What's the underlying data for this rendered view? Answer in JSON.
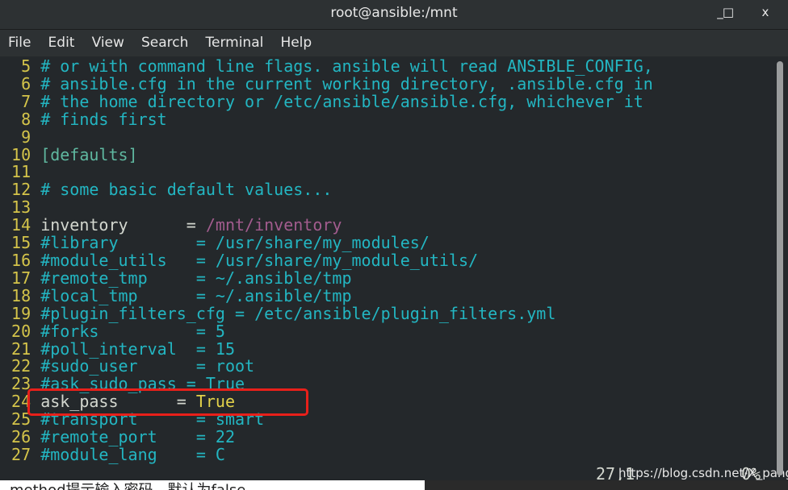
{
  "window": {
    "title": "root@ansible:/mnt",
    "minimize": "_",
    "maximize": "□",
    "close": "x"
  },
  "menu": [
    "File",
    "Edit",
    "View",
    "Search",
    "Terminal",
    "Help"
  ],
  "colors": {
    "comment": "#23b6c2",
    "linenum": "#d4c44a",
    "plain": "#d3d7cf",
    "path": "#a25c8e",
    "section": "#5fb8a0",
    "value_true": "#e3d24a",
    "highlight_box": "#e8201a"
  },
  "lines": [
    {
      "n": "5",
      "segs": [
        {
          "t": "# or with command line flags. ansible will read ANSIBLE_CONFIG,",
          "c": "comment"
        }
      ]
    },
    {
      "n": "6",
      "segs": [
        {
          "t": "# ansible.cfg in the current working directory, .ansible.cfg in",
          "c": "comment"
        }
      ]
    },
    {
      "n": "7",
      "segs": [
        {
          "t": "# the home directory or /etc/ansible/ansible.cfg, whichever it",
          "c": "comment"
        }
      ]
    },
    {
      "n": "8",
      "segs": [
        {
          "t": "# finds first",
          "c": "comment"
        }
      ]
    },
    {
      "n": "9",
      "segs": []
    },
    {
      "n": "10",
      "segs": [
        {
          "t": "[defaults]",
          "c": "section"
        }
      ]
    },
    {
      "n": "11",
      "segs": []
    },
    {
      "n": "12",
      "segs": [
        {
          "t": "# some basic default values...",
          "c": "comment"
        }
      ]
    },
    {
      "n": "13",
      "segs": []
    },
    {
      "n": "14",
      "segs": [
        {
          "t": "inventory      = ",
          "c": "plain"
        },
        {
          "t": "/mnt/inventory",
          "c": "path"
        }
      ]
    },
    {
      "n": "15",
      "segs": [
        {
          "t": "#library        = /usr/share/my_modules/",
          "c": "comment"
        }
      ]
    },
    {
      "n": "16",
      "segs": [
        {
          "t": "#module_utils   = /usr/share/my_module_utils/",
          "c": "comment"
        }
      ]
    },
    {
      "n": "17",
      "segs": [
        {
          "t": "#remote_tmp     = ~/.ansible/tmp",
          "c": "comment"
        }
      ]
    },
    {
      "n": "18",
      "segs": [
        {
          "t": "#local_tmp      = ~/.ansible/tmp",
          "c": "comment"
        }
      ]
    },
    {
      "n": "19",
      "segs": [
        {
          "t": "#plugin_filters_cfg = /etc/ansible/plugin_filters.yml",
          "c": "comment"
        }
      ]
    },
    {
      "n": "20",
      "segs": [
        {
          "t": "#forks          = 5",
          "c": "comment"
        }
      ]
    },
    {
      "n": "21",
      "segs": [
        {
          "t": "#poll_interval  = 15",
          "c": "comment"
        }
      ]
    },
    {
      "n": "22",
      "segs": [
        {
          "t": "#sudo_user      = root",
          "c": "comment"
        }
      ]
    },
    {
      "n": "23",
      "segs": [
        {
          "t": "#ask_sudo_pass = True",
          "c": "comment"
        }
      ]
    },
    {
      "n": "24",
      "segs": [
        {
          "t": "ask_pass      = ",
          "c": "plain"
        },
        {
          "t": "True",
          "c": "value_true"
        }
      ]
    },
    {
      "n": "25",
      "segs": [
        {
          "t": "#transport      = smart",
          "c": "comment"
        }
      ]
    },
    {
      "n": "26",
      "segs": [
        {
          "t": "#remote_port    = 22",
          "c": "comment"
        }
      ]
    },
    {
      "n": "27",
      "segs": [
        {
          "t": "#module_lang    = C",
          "c": "comment"
        }
      ]
    }
  ],
  "status": {
    "position": "27,1",
    "percent": "0%"
  },
  "watermark": "https://blog.csdn.net/X_pang",
  "below_text": "method提示输入密码，默认为false"
}
